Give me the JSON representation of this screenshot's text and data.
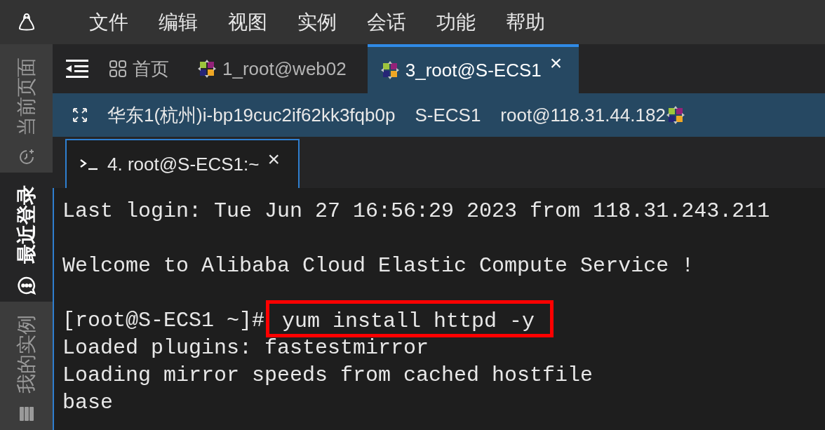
{
  "menu": [
    "文件",
    "编辑",
    "视图",
    "实例",
    "会话",
    "功能",
    "帮助"
  ],
  "sidebar": [
    {
      "label": "当前页面",
      "selected": false
    },
    {
      "label": "最近登录",
      "selected": true
    },
    {
      "label": "我的实例",
      "selected": false
    }
  ],
  "tabs": [
    {
      "label": "首页",
      "kind": "home",
      "selected": false,
      "closable": false
    },
    {
      "label": "1_root@web02",
      "kind": "session",
      "selected": false,
      "closable": false
    },
    {
      "label": "3_root@S-ECS1",
      "kind": "session",
      "selected": true,
      "closable": true,
      "close": "×"
    }
  ],
  "info_bar": {
    "instance": "华东1(杭州)i-bp19cuc2if62kk3fqb0p",
    "name": "S-ECS1",
    "address": "root@118.31.44.182"
  },
  "terminal_tab": {
    "label": "4. root@S-ECS1:~",
    "close": "×"
  },
  "terminal_lines": [
    {
      "kind": "text",
      "text": "Last login: Tue Jun 27 16:56:29 2023 from 118.31.243.211"
    },
    {
      "kind": "blank"
    },
    {
      "kind": "text",
      "text": "Welcome to Alibaba Cloud Elastic Compute Service !"
    },
    {
      "kind": "blank"
    },
    {
      "kind": "command",
      "prompt": "[root@S-ECS1 ~]#",
      "command": " yum install httpd -y",
      "highlighted": true
    },
    {
      "kind": "text",
      "text": "Loaded plugins: fastestmirror"
    },
    {
      "kind": "text",
      "text": "Loading mirror speeds from cached hostfile"
    },
    {
      "kind": "text",
      "text": "base"
    }
  ]
}
